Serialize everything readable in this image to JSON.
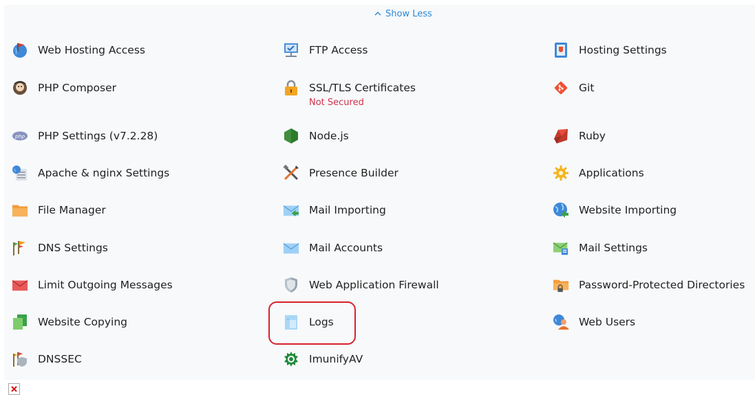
{
  "show_less": {
    "label": "Show Less",
    "icon": "chevron-up-icon"
  },
  "items": [
    {
      "label": "Web Hosting Access",
      "icon": "globe-flag-icon"
    },
    {
      "label": "FTP Access",
      "icon": "ftp-monitor-icon"
    },
    {
      "label": "Hosting Settings",
      "icon": "hosting-settings-icon"
    },
    {
      "label": "PHP Composer",
      "icon": "composer-icon"
    },
    {
      "label": "SSL/TLS Certificates",
      "icon": "padlock-icon",
      "status": "Not Secured"
    },
    {
      "label": "Git",
      "icon": "git-icon"
    },
    {
      "label": "PHP Settings (v7.2.28)",
      "icon": "php-icon"
    },
    {
      "label": "Node.js",
      "icon": "nodejs-hexagon-icon"
    },
    {
      "label": "Ruby",
      "icon": "ruby-gem-icon"
    },
    {
      "label": "Apache & nginx Settings",
      "icon": "server-globe-icon"
    },
    {
      "label": "Presence Builder",
      "icon": "tools-icon"
    },
    {
      "label": "Applications",
      "icon": "gear-icon"
    },
    {
      "label": "File Manager",
      "icon": "folder-icon"
    },
    {
      "label": "Mail Importing",
      "icon": "mail-import-icon"
    },
    {
      "label": "Website Importing",
      "icon": "globe-import-icon"
    },
    {
      "label": "DNS Settings",
      "icon": "dns-flags-icon"
    },
    {
      "label": "Mail Accounts",
      "icon": "envelope-icon"
    },
    {
      "label": "Mail Settings",
      "icon": "mail-settings-icon"
    },
    {
      "label": "Limit Outgoing Messages",
      "icon": "red-envelope-icon"
    },
    {
      "label": "Web Application Firewall",
      "icon": "shield-icon"
    },
    {
      "label": "Password-Protected Directories",
      "icon": "locked-folder-icon"
    },
    {
      "label": "Website Copying",
      "icon": "copy-pages-icon"
    },
    {
      "label": "Logs",
      "icon": "log-file-icon"
    },
    {
      "label": "Web Users",
      "icon": "web-user-icon"
    },
    {
      "label": "DNSSEC",
      "icon": "dnssec-shield-icon"
    },
    {
      "label": "ImunifyAV",
      "icon": "imunify-icon"
    }
  ],
  "colors": {
    "link": "#2d8ad6",
    "warning": "#d0334a",
    "highlight": "#d9202a",
    "panel": "#f7f9fb"
  },
  "broken_image": {
    "icon": "broken-image-icon"
  }
}
